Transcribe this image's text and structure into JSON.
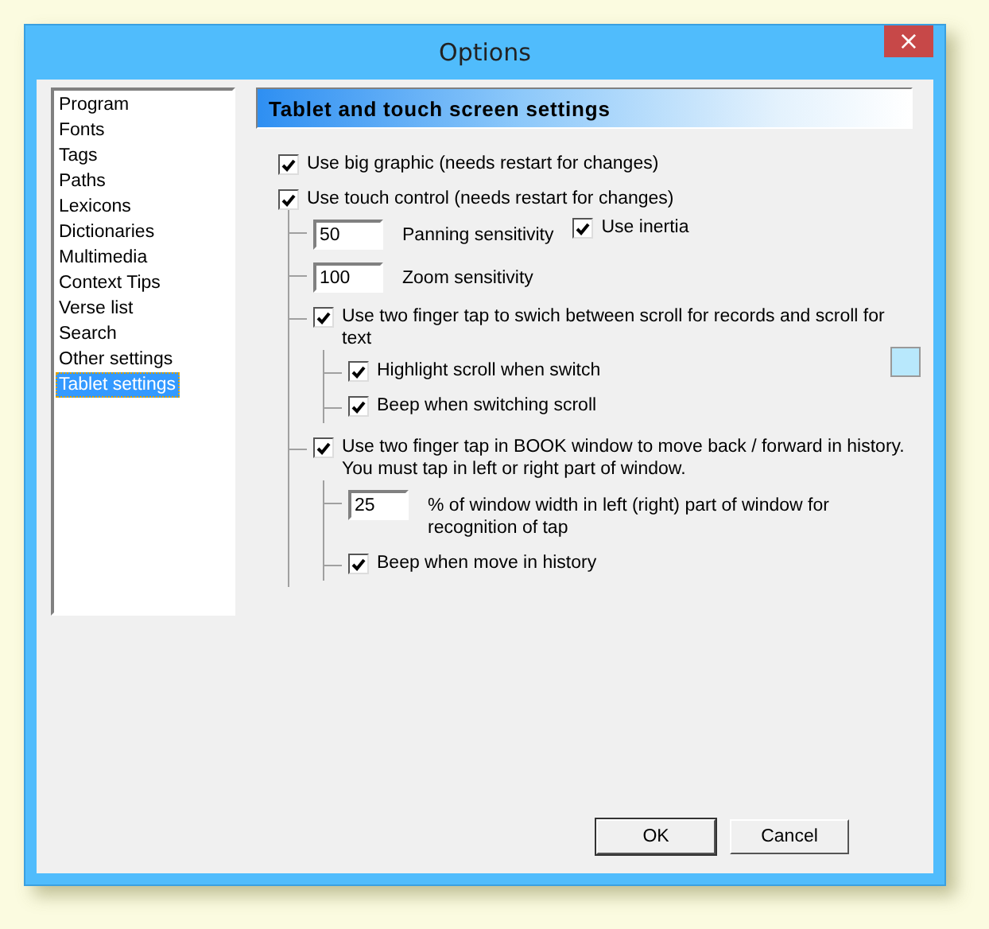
{
  "window": {
    "title": "Options",
    "close": "×"
  },
  "sidebar": {
    "items": [
      {
        "label": "Program",
        "selected": false
      },
      {
        "label": "Fonts",
        "selected": false
      },
      {
        "label": "Tags",
        "selected": false
      },
      {
        "label": "Paths",
        "selected": false
      },
      {
        "label": "Lexicons",
        "selected": false
      },
      {
        "label": "Dictionaries",
        "selected": false
      },
      {
        "label": "Multimedia",
        "selected": false
      },
      {
        "label": "Context Tips",
        "selected": false
      },
      {
        "label": "Verse list",
        "selected": false
      },
      {
        "label": "Search",
        "selected": false
      },
      {
        "label": "Other settings",
        "selected": false
      },
      {
        "label": "Tablet settings",
        "selected": true
      }
    ]
  },
  "header": "Tablet and touch screen settings",
  "settings": [
    {
      "kind": "checkbox",
      "label": "Use big graphic (needs restart for changes)",
      "checked": true
    },
    {
      "kind": "checkbox",
      "label": "Use touch control (needs restart for changes)",
      "checked": true,
      "children": [
        {
          "kind": "field",
          "value": "50",
          "label": "Panning sensitivity",
          "side_option": {
            "label": "Use inertia",
            "checked": true
          }
        },
        {
          "kind": "field",
          "value": "100",
          "label": "Zoom sensitivity"
        },
        {
          "kind": "checkbox",
          "label": "Use two finger tap to swich between scroll for records and scroll for text",
          "checked": true,
          "children": [
            {
              "kind": "checkbox",
              "label": "Highlight scroll when switch",
              "checked": true,
              "color": "#b8e8fc"
            },
            {
              "kind": "checkbox",
              "label": "Beep when switching scroll",
              "checked": true
            }
          ]
        },
        {
          "kind": "checkbox",
          "label": "Use two finger tap in BOOK window to move back / forward in history. You must tap in left or right part of window.",
          "checked": true,
          "children": [
            {
              "kind": "field",
              "value": "25",
              "label": "% of window width in left (right) part of window for recognition of tap"
            },
            {
              "kind": "checkbox",
              "label": "Beep when move in history",
              "checked": true
            }
          ]
        }
      ]
    }
  ],
  "buttons": [
    "OK",
    "Cancel"
  ]
}
